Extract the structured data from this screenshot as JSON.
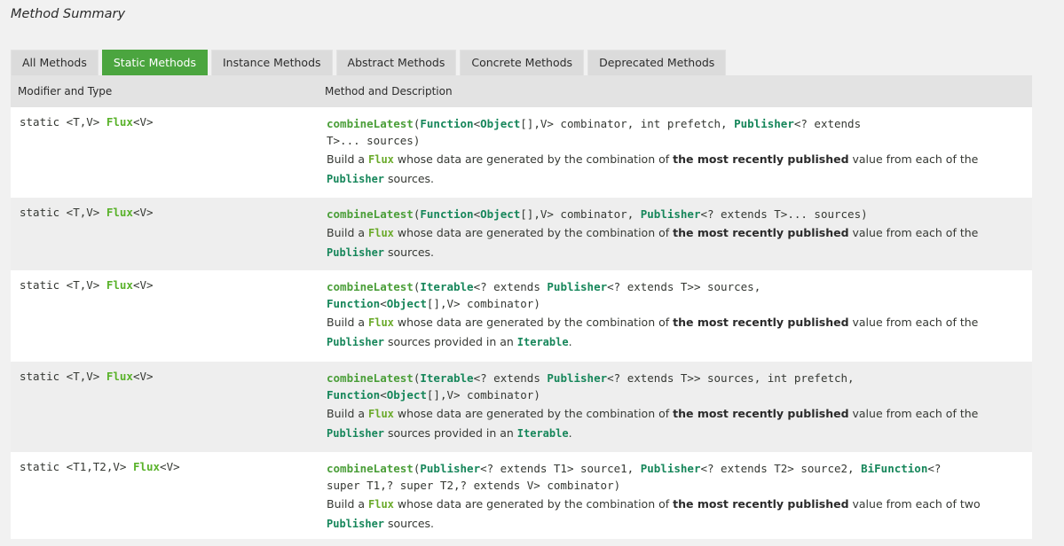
{
  "section_title": "Method Summary",
  "tabs": [
    {
      "label": "All Methods",
      "active": false
    },
    {
      "label": "Static Methods",
      "active": true
    },
    {
      "label": "Instance Methods",
      "active": false
    },
    {
      "label": "Abstract Methods",
      "active": false
    },
    {
      "label": "Concrete Methods",
      "active": false
    },
    {
      "label": "Deprecated Methods",
      "active": false
    }
  ],
  "columns": {
    "modifier": "Modifier and Type",
    "method": "Method and Description"
  },
  "colors": {
    "active_tab": "#4ba53f",
    "link": "#16865a",
    "type_link": "#59b22a"
  },
  "rows": [
    {
      "modifier_prefix": "static <T,V> ",
      "modifier_type": "Flux",
      "modifier_suffix": "<V>",
      "sig": [
        {
          "t": "combineLatest",
          "k": "m"
        },
        {
          "t": "("
        },
        {
          "t": "Function",
          "k": "l"
        },
        {
          "t": "<"
        },
        {
          "t": "Object",
          "k": "l"
        },
        {
          "t": "[],V> combinator, int prefetch, "
        },
        {
          "t": "Publisher",
          "k": "l"
        },
        {
          "t": "<? extends"
        },
        {
          "t": "\n"
        },
        {
          "t": "T>... sources)"
        }
      ],
      "desc": [
        {
          "t": "Build a "
        },
        {
          "t": "Flux",
          "k": "c"
        },
        {
          "t": " whose data are generated by the combination of "
        },
        {
          "t": "the most recently published",
          "k": "b"
        },
        {
          "t": " value from each of the"
        },
        {
          "t": "\n"
        },
        {
          "t": "Publisher",
          "k": "c"
        },
        {
          "t": " sources."
        }
      ]
    },
    {
      "modifier_prefix": "static <T,V> ",
      "modifier_type": "Flux",
      "modifier_suffix": "<V>",
      "sig": [
        {
          "t": "combineLatest",
          "k": "m"
        },
        {
          "t": "("
        },
        {
          "t": "Function",
          "k": "l"
        },
        {
          "t": "<"
        },
        {
          "t": "Object",
          "k": "l"
        },
        {
          "t": "[],V> combinator, "
        },
        {
          "t": "Publisher",
          "k": "l"
        },
        {
          "t": "<? extends T>... sources)"
        }
      ],
      "desc": [
        {
          "t": "Build a "
        },
        {
          "t": "Flux",
          "k": "c"
        },
        {
          "t": " whose data are generated by the combination of "
        },
        {
          "t": "the most recently published",
          "k": "b"
        },
        {
          "t": " value from each of the"
        },
        {
          "t": "\n"
        },
        {
          "t": "Publisher",
          "k": "c"
        },
        {
          "t": " sources."
        }
      ]
    },
    {
      "modifier_prefix": "static <T,V> ",
      "modifier_type": "Flux",
      "modifier_suffix": "<V>",
      "sig": [
        {
          "t": "combineLatest",
          "k": "m"
        },
        {
          "t": "("
        },
        {
          "t": "Iterable",
          "k": "l"
        },
        {
          "t": "<? extends "
        },
        {
          "t": "Publisher",
          "k": "l"
        },
        {
          "t": "<? extends T>> sources,"
        },
        {
          "t": "\n"
        },
        {
          "t": "Function",
          "k": "l"
        },
        {
          "t": "<"
        },
        {
          "t": "Object",
          "k": "l"
        },
        {
          "t": "[],V> combinator)"
        }
      ],
      "desc": [
        {
          "t": "Build a "
        },
        {
          "t": "Flux",
          "k": "c"
        },
        {
          "t": " whose data are generated by the combination of "
        },
        {
          "t": "the most recently published",
          "k": "b"
        },
        {
          "t": " value from each of the"
        },
        {
          "t": "\n"
        },
        {
          "t": "Publisher",
          "k": "c"
        },
        {
          "t": " sources provided in an "
        },
        {
          "t": "Iterable",
          "k": "c"
        },
        {
          "t": "."
        }
      ]
    },
    {
      "modifier_prefix": "static <T,V> ",
      "modifier_type": "Flux",
      "modifier_suffix": "<V>",
      "sig": [
        {
          "t": "combineLatest",
          "k": "m"
        },
        {
          "t": "("
        },
        {
          "t": "Iterable",
          "k": "l"
        },
        {
          "t": "<? extends "
        },
        {
          "t": "Publisher",
          "k": "l"
        },
        {
          "t": "<? extends T>> sources, int prefetch,"
        },
        {
          "t": "\n"
        },
        {
          "t": "Function",
          "k": "l"
        },
        {
          "t": "<"
        },
        {
          "t": "Object",
          "k": "l"
        },
        {
          "t": "[],V> combinator)"
        }
      ],
      "desc": [
        {
          "t": "Build a "
        },
        {
          "t": "Flux",
          "k": "c"
        },
        {
          "t": " whose data are generated by the combination of "
        },
        {
          "t": "the most recently published",
          "k": "b"
        },
        {
          "t": " value from each of the"
        },
        {
          "t": "\n"
        },
        {
          "t": "Publisher",
          "k": "c"
        },
        {
          "t": " sources provided in an "
        },
        {
          "t": "Iterable",
          "k": "c"
        },
        {
          "t": "."
        }
      ]
    },
    {
      "modifier_prefix": "static <T1,T2,V> ",
      "modifier_type": "Flux",
      "modifier_suffix": "<V>",
      "sig": [
        {
          "t": "combineLatest",
          "k": "m"
        },
        {
          "t": "("
        },
        {
          "t": "Publisher",
          "k": "l"
        },
        {
          "t": "<? extends T1> source1, "
        },
        {
          "t": "Publisher",
          "k": "l"
        },
        {
          "t": "<? extends T2> source2, "
        },
        {
          "t": "BiFunction",
          "k": "l"
        },
        {
          "t": "<?"
        },
        {
          "t": "\n"
        },
        {
          "t": "super T1,? super T2,? extends V> combinator)"
        }
      ],
      "desc": [
        {
          "t": "Build a "
        },
        {
          "t": "Flux",
          "k": "c"
        },
        {
          "t": " whose data are generated by the combination of "
        },
        {
          "t": "the most recently published",
          "k": "b"
        },
        {
          "t": " value from each of two"
        },
        {
          "t": "\n"
        },
        {
          "t": "Publisher",
          "k": "c"
        },
        {
          "t": " sources."
        }
      ]
    }
  ]
}
